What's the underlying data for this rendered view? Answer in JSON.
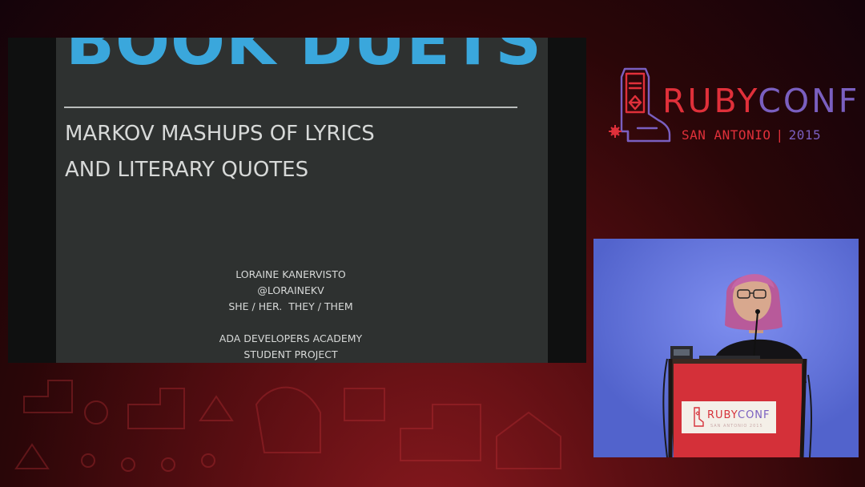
{
  "slide": {
    "title": "BOOK DUETS",
    "subtitle_lines": [
      "MARKOV MASHUPS OF LYRICS",
      "AND LITERARY QUOTES"
    ],
    "speaker_name": "LORAINE KANERVISTO",
    "speaker_handle": "@LORAINEKV",
    "speaker_pronouns": "SHE / HER.  THEY / THEM",
    "org": "ADA DEVELOPERS ACADEMY",
    "project": "STUDENT PROJECT"
  },
  "conference": {
    "name_part1": "RUBY",
    "name_part2": "CONF",
    "location": "SAN ANTONIO",
    "separator": "|",
    "year": "2015",
    "podium_name_part1": "RUBY",
    "podium_name_part2": "CONF",
    "podium_subtext": "SAN ANTONIO 2015"
  },
  "colors": {
    "slide_title": "#3aa7dc",
    "slide_text": "#d7d9d8",
    "slide_bg": "#2e3130",
    "brand_red": "#e0303a",
    "brand_purple": "#7a5fc0",
    "camera_backdrop": "#6a7be0"
  },
  "icons": {
    "logo": "cowboy-boot-icon",
    "background": "western-pattern"
  }
}
